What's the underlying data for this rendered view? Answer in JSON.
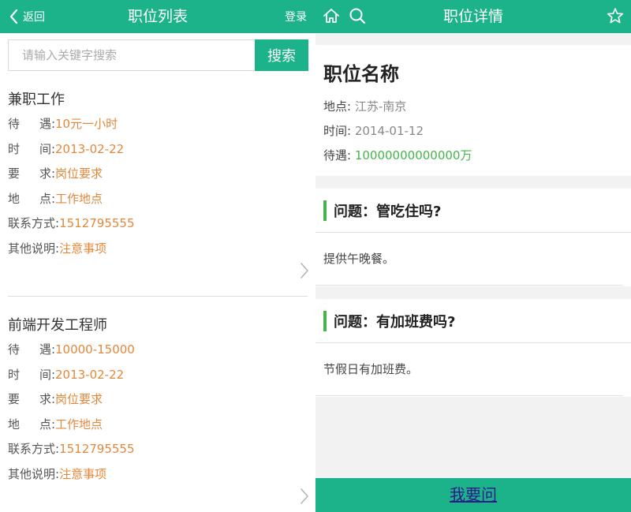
{
  "left": {
    "header": {
      "back_label": "返回",
      "title": "职位列表",
      "login_label": "登录"
    },
    "search": {
      "placeholder": "请输入关键字搜索",
      "button_label": "搜索"
    },
    "jobs": [
      {
        "title": "兼职工作",
        "rows": [
          {
            "label_a": "待",
            "label_b": "遇:",
            "value": "10元一小时"
          },
          {
            "label_a": "时",
            "label_b": "间:",
            "value": "2013-02-22"
          },
          {
            "label_a": "要",
            "label_b": "求:",
            "value": "岗位要求"
          },
          {
            "label_a": "地",
            "label_b": "点:",
            "value": "工作地点"
          },
          {
            "label": "联系方式:",
            "value": "1512795555"
          },
          {
            "label": "其他说明:",
            "value": "注意事项"
          }
        ]
      },
      {
        "title": "前端开发工程师",
        "rows": [
          {
            "label_a": "待",
            "label_b": "遇:",
            "value": "10000-15000"
          },
          {
            "label_a": "时",
            "label_b": "间:",
            "value": "2013-02-22"
          },
          {
            "label_a": "要",
            "label_b": "求:",
            "value": "岗位要求"
          },
          {
            "label_a": "地",
            "label_b": "点:",
            "value": "工作地点"
          },
          {
            "label": "联系方式:",
            "value": "1512795555"
          },
          {
            "label": "其他说明:",
            "value": "注意事项"
          }
        ]
      }
    ]
  },
  "right": {
    "header": {
      "title": "职位详情"
    },
    "detail": {
      "name": "职位名称",
      "location_label": "地点:",
      "location_value": "江苏-南京",
      "time_label": "时间:",
      "time_value": "2014-01-12",
      "pay_label": "待遇:",
      "pay_value": "10000000000000万"
    },
    "questions": [
      {
        "question": "问题：管吃住吗?",
        "answer": "提供午晚餐。"
      },
      {
        "question": "问题：有加班费吗?",
        "answer": "节假日有加班费。"
      }
    ],
    "ask_label": "我要问"
  },
  "colors": {
    "brand_green": "#1db38a",
    "accent_orange": "#e3883a",
    "pay_green": "#43b54b"
  },
  "icons": [
    "back-chevron-icon",
    "home-icon",
    "search-icon",
    "star-icon",
    "chevron-right-icon"
  ]
}
